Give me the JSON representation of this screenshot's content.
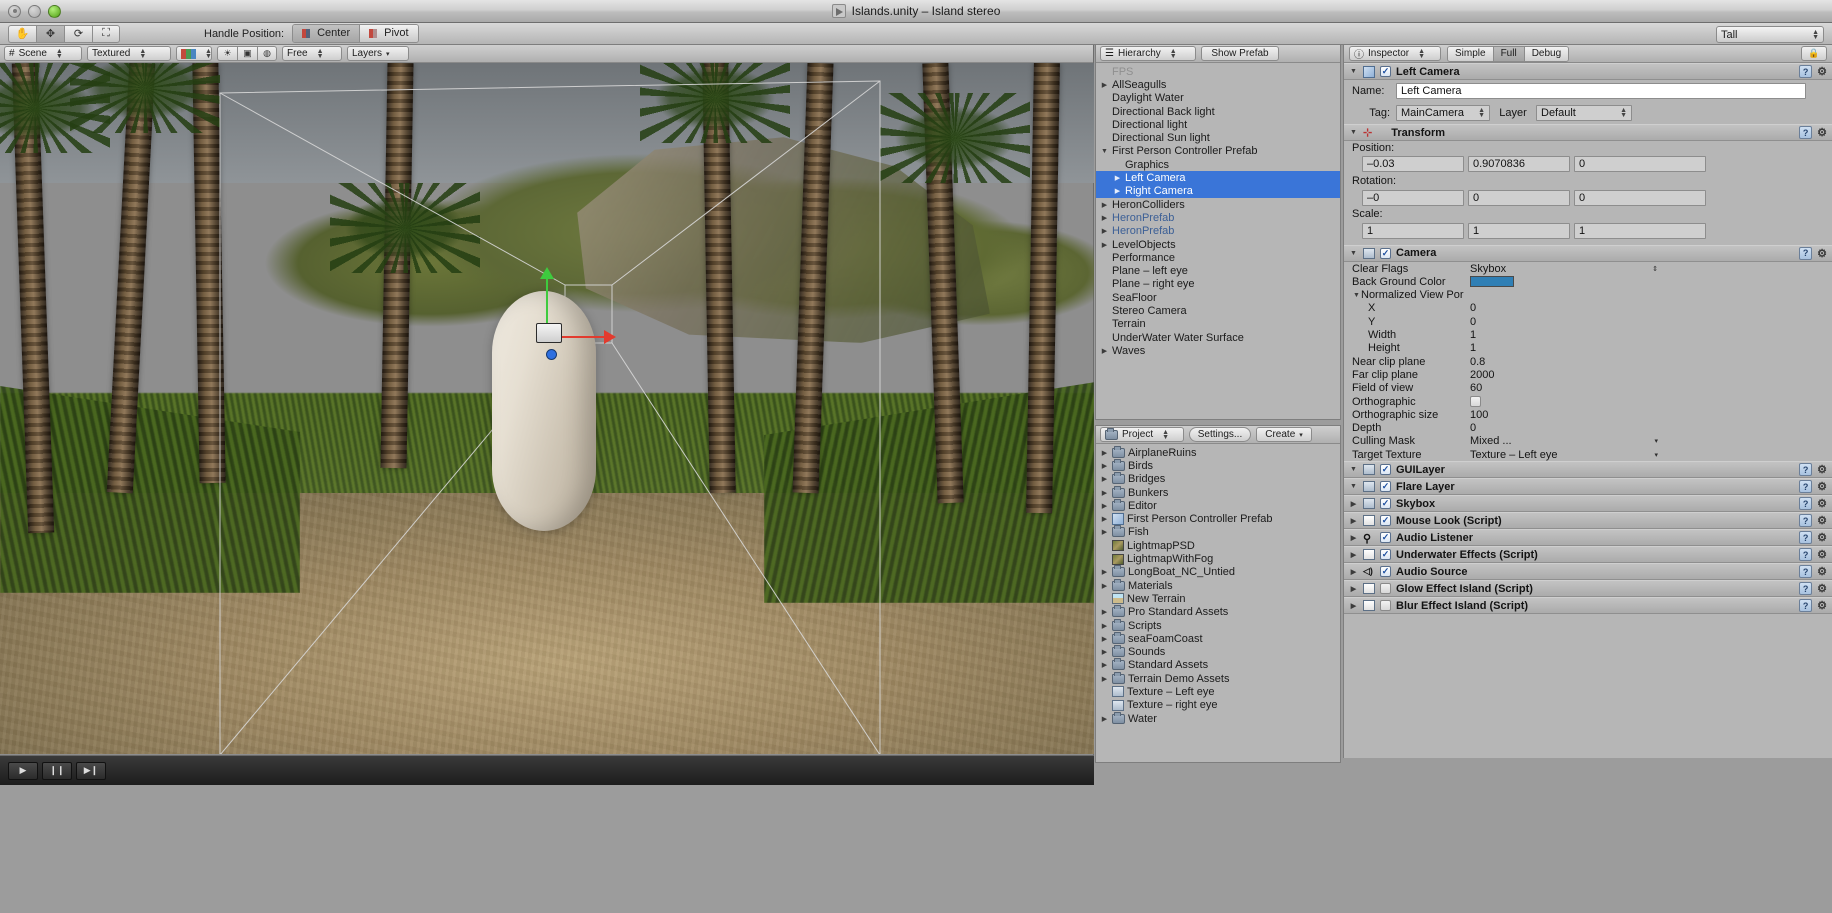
{
  "window": {
    "title": "Islands.unity – Island stereo",
    "app_icon": "unity-logo-icon"
  },
  "toolbar": {
    "tools": [
      {
        "name": "hand-tool",
        "glyph": "✋"
      },
      {
        "name": "move-tool",
        "glyph": "✥"
      },
      {
        "name": "rotate-tool",
        "glyph": "⟳"
      },
      {
        "name": "scale-tool",
        "glyph": "⛶"
      }
    ],
    "handle_position_label": "Handle Position:",
    "handle_center": "Center",
    "handle_pivot": "Pivot",
    "layout_dropdown": "Tall"
  },
  "scene_toolbar": {
    "view_tab": "Scene",
    "draw_mode": "Textured",
    "render_mode_icon": "rgb-swatch-icon",
    "light_icon": "sun-icon",
    "fx_icon": "image-icon",
    "audio_icon": "globe-icon",
    "camera_mode": "Free",
    "layers": "Layers"
  },
  "hierarchy": {
    "tab_label": "Hierarchy",
    "show_prefab_button": "Show Prefab",
    "watermark": "FPS",
    "items": [
      {
        "label": "AllSeagulls",
        "arrow": "▶",
        "indent": 0,
        "selected": false,
        "style": "normal"
      },
      {
        "label": "Daylight Water",
        "arrow": "",
        "indent": 0,
        "selected": false,
        "style": "normal"
      },
      {
        "label": "Directional Back light",
        "arrow": "",
        "indent": 0,
        "selected": false,
        "style": "normal"
      },
      {
        "label": "Directional light",
        "arrow": "",
        "indent": 0,
        "selected": false,
        "style": "normal"
      },
      {
        "label": "Directional Sun light",
        "arrow": "",
        "indent": 0,
        "selected": false,
        "style": "normal"
      },
      {
        "label": "First Person Controller Prefab",
        "arrow": "▼",
        "indent": 0,
        "selected": false,
        "style": "normal"
      },
      {
        "label": "Graphics",
        "arrow": "",
        "indent": 1,
        "selected": false,
        "style": "normal"
      },
      {
        "label": "Left Camera",
        "arrow": "",
        "indent": 1,
        "selected": true,
        "style": "normal"
      },
      {
        "label": "Right Camera",
        "arrow": "",
        "indent": 1,
        "selected": true,
        "style": "normal"
      },
      {
        "label": "HeronColliders",
        "arrow": "▶",
        "indent": 0,
        "selected": false,
        "style": "normal"
      },
      {
        "label": "HeronPrefab",
        "arrow": "▶",
        "indent": 0,
        "selected": false,
        "style": "prefab"
      },
      {
        "label": "HeronPrefab",
        "arrow": "▶",
        "indent": 0,
        "selected": false,
        "style": "prefab"
      },
      {
        "label": "LevelObjects",
        "arrow": "▶",
        "indent": 0,
        "selected": false,
        "style": "normal"
      },
      {
        "label": "Performance",
        "arrow": "",
        "indent": 0,
        "selected": false,
        "style": "normal"
      },
      {
        "label": "Plane – left eye",
        "arrow": "",
        "indent": 0,
        "selected": false,
        "style": "normal"
      },
      {
        "label": "Plane – right eye",
        "arrow": "",
        "indent": 0,
        "selected": false,
        "style": "normal"
      },
      {
        "label": "SeaFloor",
        "arrow": "",
        "indent": 0,
        "selected": false,
        "style": "normal"
      },
      {
        "label": "Stereo Camera",
        "arrow": "",
        "indent": 0,
        "selected": false,
        "style": "normal"
      },
      {
        "label": "Terrain",
        "arrow": "",
        "indent": 0,
        "selected": false,
        "style": "normal"
      },
      {
        "label": "UnderWater Water Surface",
        "arrow": "",
        "indent": 0,
        "selected": false,
        "style": "normal"
      },
      {
        "label": "Waves",
        "arrow": "▶",
        "indent": 0,
        "selected": false,
        "style": "normal"
      }
    ]
  },
  "project": {
    "tab_label": "Project",
    "settings_button": "Settings...",
    "create_button": "Create",
    "items": [
      {
        "label": "AirplaneRuins",
        "arrow": "▶",
        "icon": "folder"
      },
      {
        "label": "Birds",
        "arrow": "▶",
        "icon": "folder"
      },
      {
        "label": "Bridges",
        "arrow": "▶",
        "icon": "folder"
      },
      {
        "label": "Bunkers",
        "arrow": "▶",
        "icon": "folder"
      },
      {
        "label": "Editor",
        "arrow": "▶",
        "icon": "folder"
      },
      {
        "label": "First Person Controller Prefab",
        "arrow": "▶",
        "icon": "prefab"
      },
      {
        "label": "Fish",
        "arrow": "▶",
        "icon": "folder"
      },
      {
        "label": "LightmapPSD",
        "arrow": "",
        "icon": "image"
      },
      {
        "label": "LightmapWithFog",
        "arrow": "",
        "icon": "image"
      },
      {
        "label": "LongBoat_NC_Untied",
        "arrow": "▶",
        "icon": "folder"
      },
      {
        "label": "Materials",
        "arrow": "▶",
        "icon": "folder"
      },
      {
        "label": "New Terrain",
        "arrow": "",
        "icon": "terrain"
      },
      {
        "label": "Pro Standard Assets",
        "arrow": "▶",
        "icon": "folder"
      },
      {
        "label": "Scripts",
        "arrow": "▶",
        "icon": "folder"
      },
      {
        "label": "seaFoamCoast",
        "arrow": "▶",
        "icon": "folder"
      },
      {
        "label": "Sounds",
        "arrow": "▶",
        "icon": "folder"
      },
      {
        "label": "Standard Assets",
        "arrow": "▶",
        "icon": "folder"
      },
      {
        "label": "Terrain Demo Assets",
        "arrow": "▶",
        "icon": "folder"
      },
      {
        "label": "Texture – Left eye",
        "arrow": "",
        "icon": "texture"
      },
      {
        "label": "Texture – right eye",
        "arrow": "",
        "icon": "texture"
      },
      {
        "label": "Water",
        "arrow": "▶",
        "icon": "folder"
      }
    ]
  },
  "inspector": {
    "tab_label": "Inspector",
    "modes": [
      "Simple",
      "Full",
      "Debug"
    ],
    "active_mode": "Full",
    "lock_icon": "lock-icon",
    "object": {
      "name": "Left Camera",
      "enabled": true,
      "name_label": "Name:",
      "name_value": "Left Camera",
      "tag_label": "Tag:",
      "tag_value": "MainCamera",
      "layer_label": "Layer",
      "layer_value": "Default"
    },
    "transform": {
      "title": "Transform",
      "position_label": "Position:",
      "position": [
        "–0.03",
        "0.9070836",
        "0"
      ],
      "rotation_label": "Rotation:",
      "rotation": [
        "–0",
        "0",
        "0"
      ],
      "scale_label": "Scale:",
      "scale": [
        "1",
        "1",
        "1"
      ]
    },
    "camera": {
      "title": "Camera",
      "enabled": true,
      "properties": [
        {
          "label": "Clear Flags",
          "value": "Skybox",
          "type": "popup",
          "indent": 0
        },
        {
          "label": "Back Ground Color",
          "value": "",
          "type": "color",
          "color": "#2f7fb5",
          "indent": 0
        },
        {
          "label": "Normalized View Por",
          "value": "",
          "type": "foldout",
          "indent": 0
        },
        {
          "label": "X",
          "value": "0",
          "type": "text",
          "indent": 2
        },
        {
          "label": "Y",
          "value": "0",
          "type": "text",
          "indent": 2
        },
        {
          "label": "Width",
          "value": "1",
          "type": "text",
          "indent": 2
        },
        {
          "label": "Height",
          "value": "1",
          "type": "text",
          "indent": 2
        },
        {
          "label": "Near clip plane",
          "value": "0.8",
          "type": "text",
          "indent": 0
        },
        {
          "label": "Far clip plane",
          "value": "2000",
          "type": "text",
          "indent": 0
        },
        {
          "label": "Field of view",
          "value": "60",
          "type": "text",
          "indent": 0
        },
        {
          "label": "Orthographic",
          "value": "",
          "type": "checkbox",
          "checked": false,
          "indent": 0
        },
        {
          "label": "Orthographic size",
          "value": "100",
          "type": "text",
          "indent": 0
        },
        {
          "label": "Depth",
          "value": "0",
          "type": "text",
          "indent": 0
        },
        {
          "label": "Culling Mask",
          "value": "Mixed ...",
          "type": "popup",
          "indent": 0
        },
        {
          "label": "Target Texture",
          "value": "Texture – Left eye",
          "type": "popup",
          "indent": 0
        }
      ]
    },
    "components": [
      {
        "title": "GUILayer",
        "enabled": true,
        "expanded": true,
        "icon": "guilayer-icon"
      },
      {
        "title": "Flare Layer",
        "enabled": true,
        "expanded": true,
        "icon": "flarelayer-icon"
      },
      {
        "title": "Skybox",
        "enabled": true,
        "expanded": false,
        "icon": "skybox-icon"
      },
      {
        "title": "Mouse Look (Script)",
        "enabled": true,
        "expanded": false,
        "icon": "script-icon"
      },
      {
        "title": "Audio Listener",
        "enabled": true,
        "expanded": false,
        "icon": "audio-listener-icon"
      },
      {
        "title": "Underwater Effects (Script)",
        "enabled": true,
        "expanded": false,
        "icon": "script-icon"
      },
      {
        "title": "Audio Source",
        "enabled": true,
        "expanded": false,
        "icon": "speaker-icon"
      },
      {
        "title": "Glow Effect Island (Script)",
        "enabled": false,
        "expanded": false,
        "icon": "script-icon"
      },
      {
        "title": "Blur Effect Island (Script)",
        "enabled": false,
        "expanded": false,
        "icon": "script-icon"
      }
    ]
  },
  "playbar": {
    "play": "▶",
    "pause": "❙❙",
    "step": "▶❙"
  },
  "colors": {
    "selection_blue": "#3a75d8",
    "prefab_blue": "#3b5f96",
    "panel_gray": "#b6b6b6",
    "background_color": "#2f7fb5",
    "gizmo_green": "#3ecb3e",
    "gizmo_red": "#e23b2e"
  }
}
